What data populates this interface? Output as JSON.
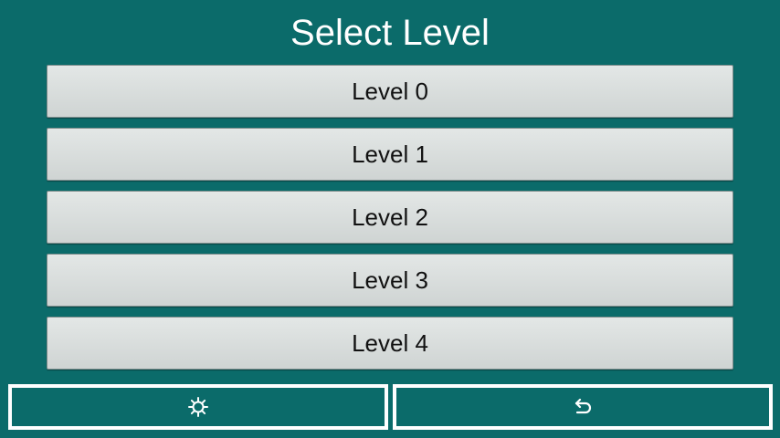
{
  "header": {
    "title": "Select Level"
  },
  "levels": [
    {
      "label": "Level 0"
    },
    {
      "label": "Level 1"
    },
    {
      "label": "Level 2"
    },
    {
      "label": "Level 3"
    },
    {
      "label": "Level 4"
    }
  ],
  "footer": {
    "settings_icon": "gear-icon",
    "back_icon": "undo-arrow-icon"
  },
  "colors": {
    "background": "#0b6b6a",
    "button_face": "#dde1e0",
    "text_light": "#ffffff",
    "text_dark": "#111111"
  }
}
